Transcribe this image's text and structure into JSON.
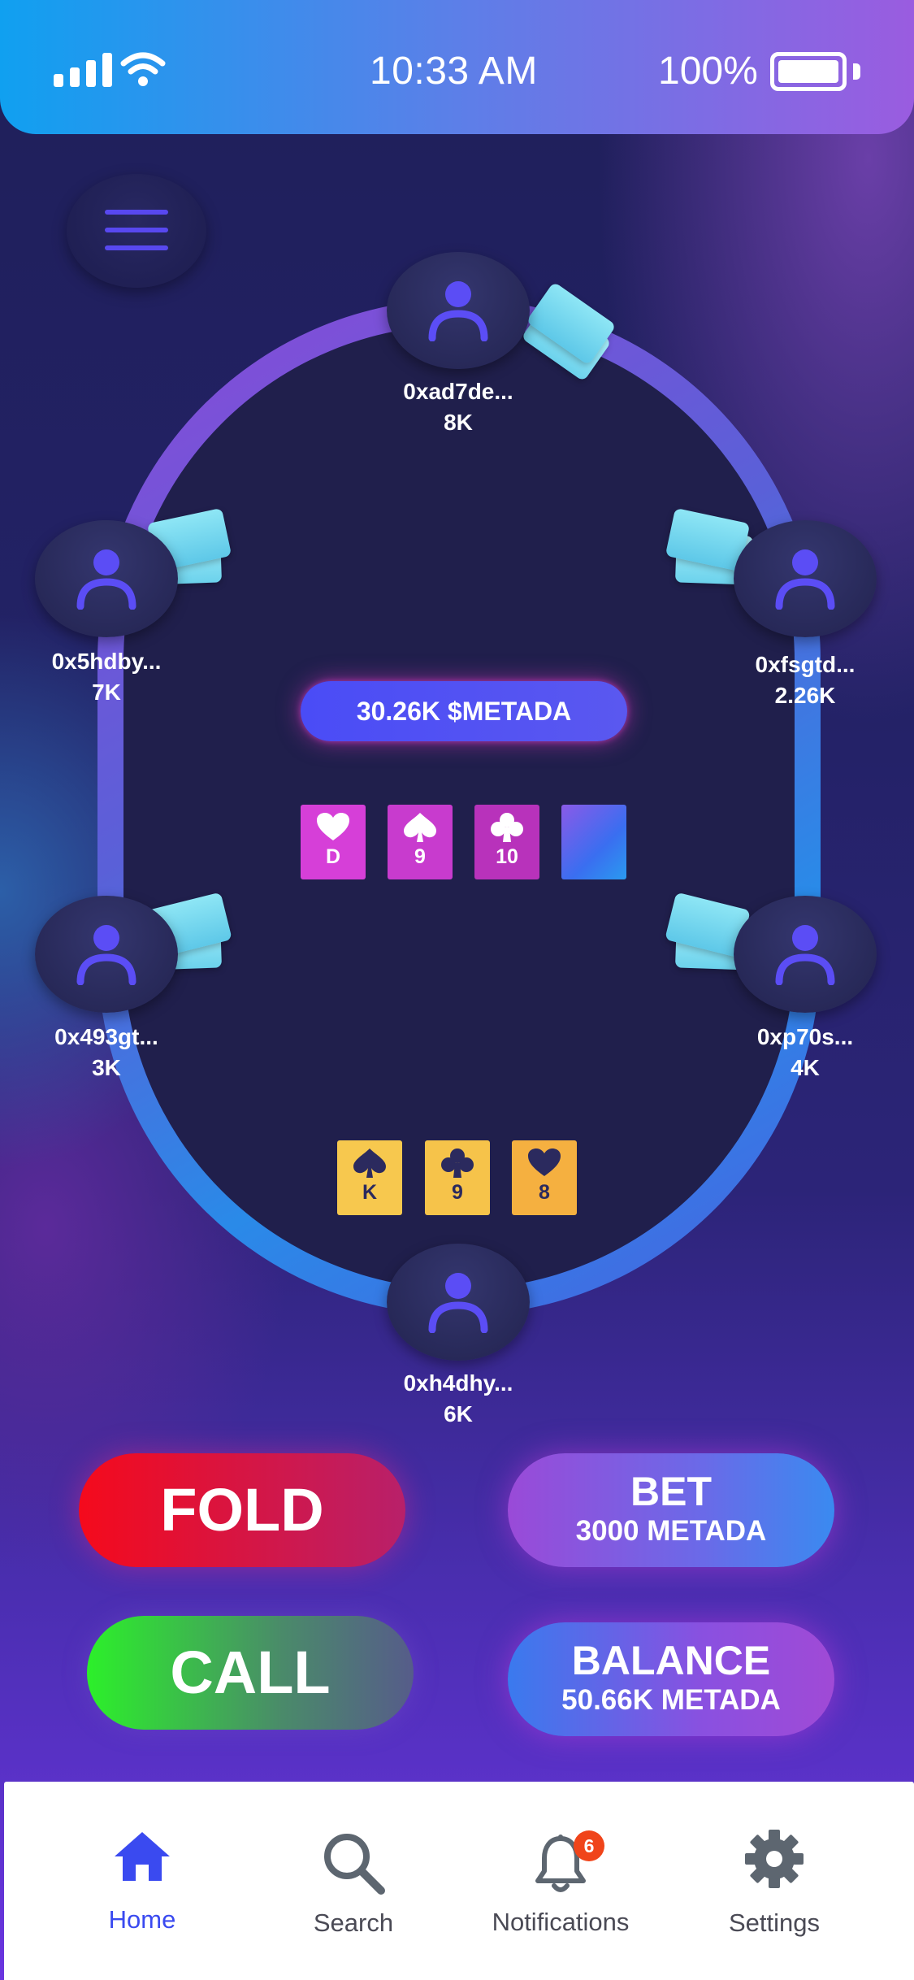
{
  "status_bar": {
    "time": "10:33 AM",
    "battery_percent": "100%",
    "battery_level": 1.0,
    "signal_bars": 4
  },
  "colors": {
    "accent": "#3a4af0",
    "fold": "#f50a1c",
    "call": "#2cf02a",
    "pot": "#4a4cf6",
    "card_hand": "#f7c84e",
    "card_community": "#d63fd8"
  },
  "menu": {
    "icon": "hamburger-menu-icon"
  },
  "table": {
    "pot": "30.26K $METADA",
    "seats": [
      {
        "id": "top",
        "name": "0xad7de...",
        "chips": "8K"
      },
      {
        "id": "left-upper",
        "name": "0x5hdby...",
        "chips": "7K"
      },
      {
        "id": "right-upper",
        "name": "0xfsgtd...",
        "chips": "2.26K"
      },
      {
        "id": "left-lower",
        "name": "0x493gt...",
        "chips": "3K"
      },
      {
        "id": "right-lower",
        "name": "0xp70s...",
        "chips": "4K"
      },
      {
        "id": "bottom",
        "name": "0xh4dhy...",
        "chips": "6K"
      }
    ],
    "community_cards": [
      {
        "suit": "heart",
        "rank": "D"
      },
      {
        "suit": "spade",
        "rank": "9"
      },
      {
        "suit": "club",
        "rank": "10"
      },
      {
        "suit": "back",
        "rank": ""
      }
    ],
    "hand_cards": [
      {
        "suit": "spade",
        "rank": "K"
      },
      {
        "suit": "club",
        "rank": "9"
      },
      {
        "suit": "heart",
        "rank": "8"
      }
    ]
  },
  "actions": {
    "fold": "FOLD",
    "call": "CALL",
    "bet_title": "BET",
    "bet_amount": "3000 METADA",
    "balance_title": "BALANCE",
    "balance_amount": "50.66K METADA"
  },
  "tabbar": {
    "items": [
      {
        "label": "Home",
        "icon": "home-icon",
        "active": true
      },
      {
        "label": "Search",
        "icon": "search-icon"
      },
      {
        "label": "Notifications",
        "icon": "bell-icon",
        "badge": "6"
      },
      {
        "label": "Settings",
        "icon": "gear-icon"
      }
    ]
  }
}
